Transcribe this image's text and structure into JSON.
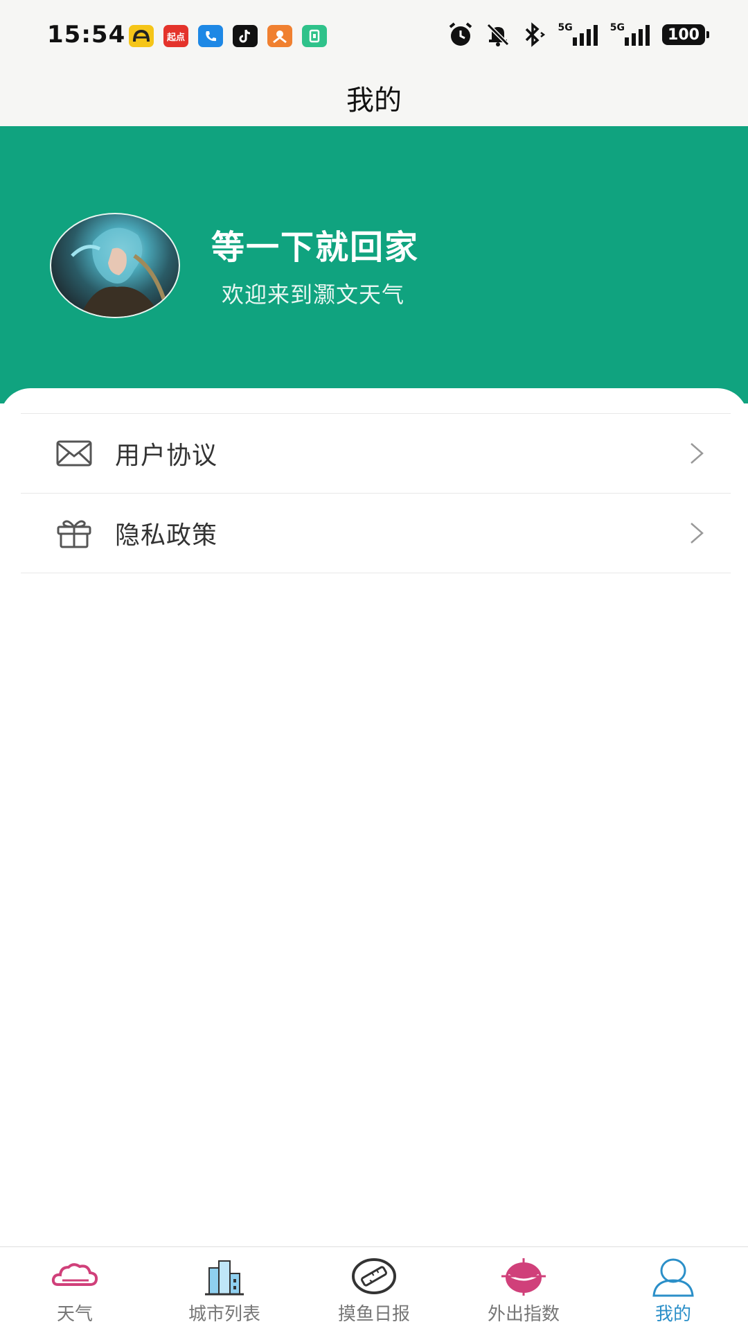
{
  "status_bar": {
    "time": "15:54",
    "notif_apps": [
      {
        "icon": "app-yellow-icon",
        "color": "#f5c518",
        "text": ""
      },
      {
        "icon": "qidian-icon",
        "color": "#e4332b",
        "text": "起点"
      },
      {
        "icon": "phone-app-icon",
        "color": "#1e88e5",
        "text": ""
      },
      {
        "icon": "tiktok-icon",
        "color": "#111111",
        "text": ""
      },
      {
        "icon": "app-orange-icon",
        "color": "#f08030",
        "text": ""
      },
      {
        "icon": "app-green-icon",
        "color": "#2fc28a",
        "text": ""
      }
    ],
    "signal_1": "5G",
    "signal_2": "5G",
    "battery": "100"
  },
  "header": {
    "title": "我的"
  },
  "profile": {
    "name": "等一下就回家",
    "welcome": "欢迎来到灏文天气",
    "banner_color": "#10a37f"
  },
  "menu": [
    {
      "icon": "envelope-icon",
      "label": "用户协议"
    },
    {
      "icon": "gift-icon",
      "label": "隐私政策"
    }
  ],
  "bottom_nav": [
    {
      "icon": "cloud-icon",
      "label": "天气",
      "active": false
    },
    {
      "icon": "city-buildings-icon",
      "label": "城市列表",
      "active": false
    },
    {
      "icon": "fish-ruler-icon",
      "label": "摸鱼日报",
      "active": false
    },
    {
      "icon": "outing-index-icon",
      "label": "外出指数",
      "active": false
    },
    {
      "icon": "user-icon",
      "label": "我的",
      "active": true
    }
  ],
  "colors": {
    "accent": "#10a37f",
    "nav_active": "#2b8fc8",
    "nav_pink": "#d0407a"
  }
}
